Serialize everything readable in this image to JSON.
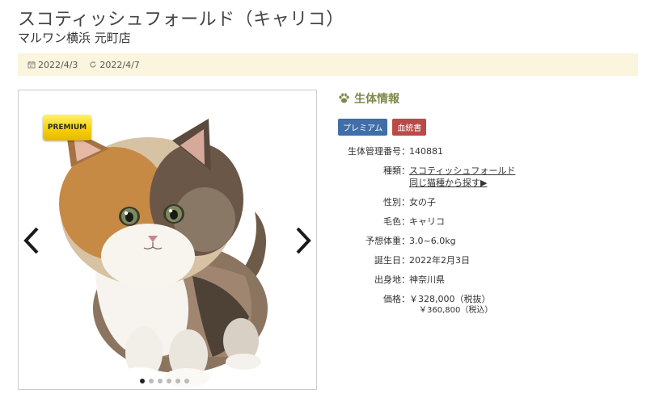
{
  "header": {
    "title": "スコティッシュフォールド（キャリコ）",
    "shop": "マルワン横浜 元町店"
  },
  "dates": {
    "posted": "2022/4/3",
    "updated": "2022/4/7"
  },
  "gallery": {
    "badge": "PREMIUM",
    "dot_count": 6,
    "active_dot": 1
  },
  "info": {
    "heading": "生体情報",
    "tags": [
      "プレミアム",
      "血統書"
    ],
    "rows": {
      "id": {
        "label": "生体管理番号",
        "value": "140881"
      },
      "breed": {
        "label": "種類",
        "value": "スコティッシュフォールド",
        "link": "同じ猫種から探す▶"
      },
      "sex": {
        "label": "性別",
        "value": "女の子"
      },
      "color": {
        "label": "毛色",
        "value": "キャリコ"
      },
      "weight": {
        "label": "予想体重",
        "value": "3.0~6.0kg"
      },
      "birthday": {
        "label": "誕生日",
        "value": "2022年2月3日"
      },
      "origin": {
        "label": "出身地",
        "value": "神奈川県"
      },
      "price": {
        "label": "価格",
        "value": "￥328,000（税抜）",
        "sub": "￥360,800（税込）"
      }
    }
  },
  "colors": {
    "accent_olive": "#7d8a4c",
    "date_bar_bg": "#faf5dc",
    "tag_premium": "#3f6ea8",
    "tag_pedigree": "#b94a48"
  },
  "icons": {
    "posted": "calendar-icon",
    "updated": "refresh-icon",
    "heading": "paw-icon",
    "prev": "chevron-left-icon",
    "next": "chevron-right-icon"
  }
}
